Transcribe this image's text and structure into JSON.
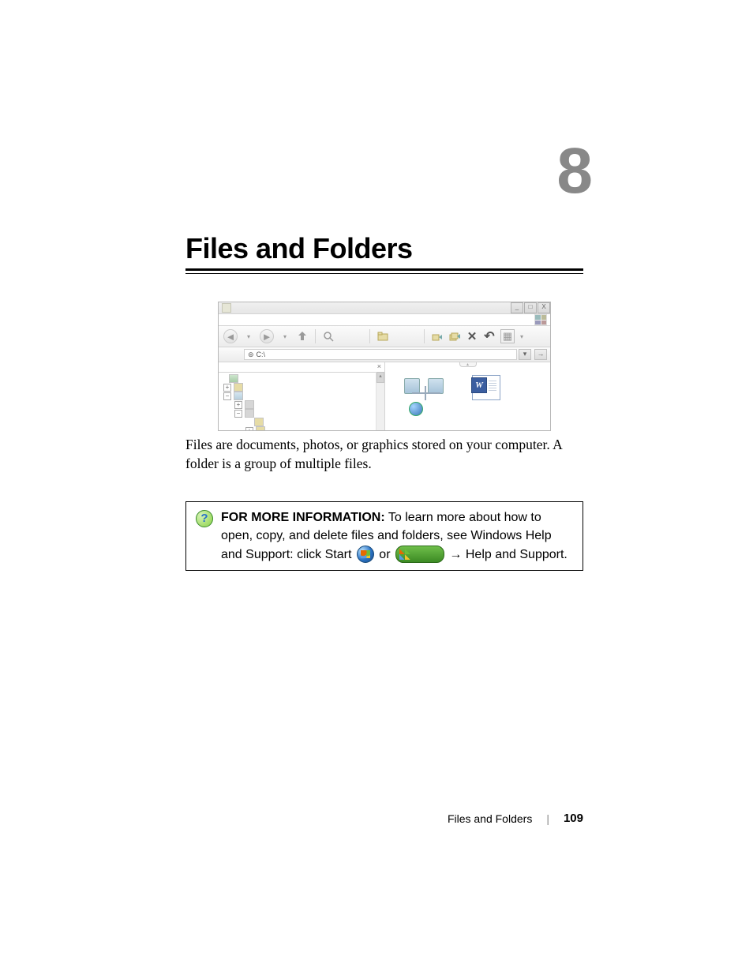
{
  "chapter_number": "8",
  "chapter_title": "Files and Folders",
  "screenshot": {
    "window_controls": {
      "min": "_",
      "max": "□",
      "close": "X"
    },
    "toolbar": {
      "back": "◄",
      "dropdown": "▾",
      "forward": "►",
      "up": "▲",
      "search": "🔍",
      "folders": "▣",
      "move": "▸",
      "copy": "▸",
      "delete": "✕",
      "undo": "↶",
      "views": "▦",
      "views_drop": "▾"
    },
    "address": {
      "drive_icon": "⊜",
      "path": "C:\\"
    },
    "go_dropdown": "▾",
    "go_arrow": "→",
    "tree": {
      "close": "×",
      "scroll_up": "▴",
      "items": [
        {
          "indent": 0,
          "expand": "",
          "icon": "desktop"
        },
        {
          "indent": 0,
          "expand": "+",
          "icon": "folder"
        },
        {
          "indent": 0,
          "expand": "−",
          "icon": "computer"
        },
        {
          "indent": 1,
          "expand": "+",
          "icon": "drive"
        },
        {
          "indent": 1,
          "expand": "−",
          "icon": "drive"
        },
        {
          "indent": 2,
          "expand": "",
          "icon": "folder"
        },
        {
          "indent": 2,
          "expand": "+",
          "icon": "folder"
        }
      ]
    },
    "content": {
      "collapse_tab": "▴",
      "word_icon_letter": "W"
    }
  },
  "body_paragraph": "Files are documents, photos, or graphics stored on your computer. A folder is a group of multiple files.",
  "info_box": {
    "help_icon_char": "?",
    "label": "FOR MORE INFORMATION:",
    "text_part1": " To learn more about how to open, copy, and delete files and folders, see Windows Help and Support: click Start ",
    "or": " or ",
    "arrow": " → ",
    "help_support": "Help and Support."
  },
  "footer": {
    "section": "Files and Folders",
    "separator": "|",
    "page": "109"
  }
}
